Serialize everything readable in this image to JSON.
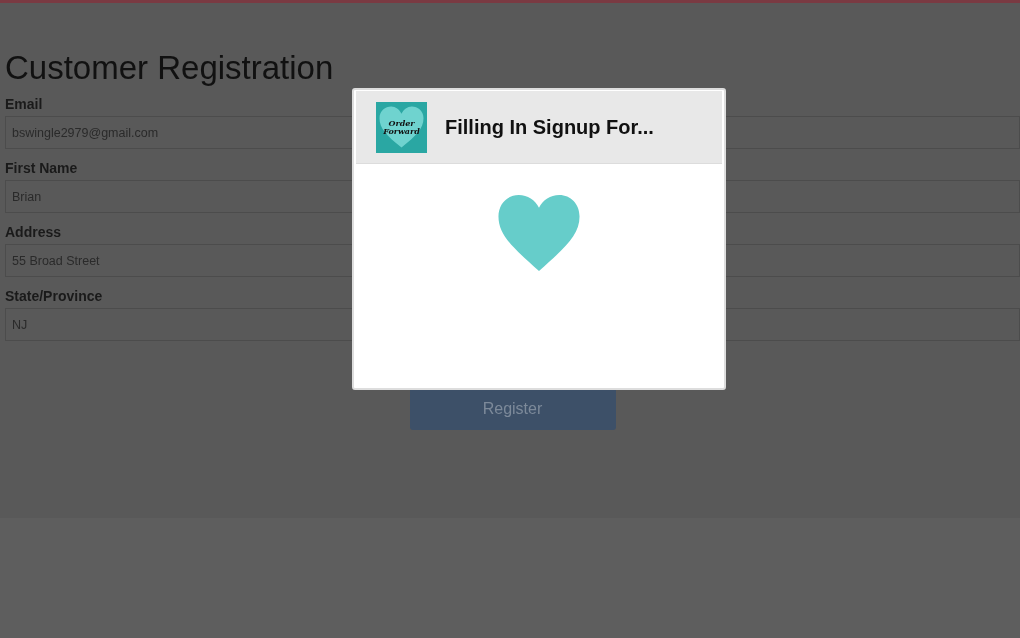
{
  "page": {
    "title": "Customer Registration"
  },
  "fields": [
    {
      "label": "Email",
      "value": "bswingle2979@gmail.com"
    },
    {
      "label": "First Name",
      "value": "Brian"
    },
    {
      "label": "Address",
      "value": "55 Broad Street"
    },
    {
      "label": "State/Province",
      "value": "NJ"
    }
  ],
  "register_button": {
    "label": "Register"
  },
  "dialog": {
    "logo_text": "Order Forward",
    "title": "Filling In Signup For..."
  }
}
